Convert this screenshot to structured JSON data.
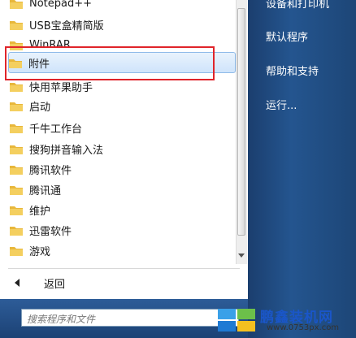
{
  "programs": [
    {
      "label": "Notepad++"
    },
    {
      "label": "USB宝盒精简版"
    },
    {
      "label": "WinRAR"
    },
    {
      "label": "附件"
    },
    {
      "label": "快用苹果助手"
    },
    {
      "label": "启动"
    },
    {
      "label": "千牛工作台"
    },
    {
      "label": "搜狗拼音输入法"
    },
    {
      "label": "腾讯软件"
    },
    {
      "label": "腾讯通"
    },
    {
      "label": "维护"
    },
    {
      "label": "迅雷软件"
    },
    {
      "label": "游戏"
    }
  ],
  "back_label": "返回",
  "search": {
    "placeholder": "搜索程序和文件"
  },
  "right_menu": [
    {
      "label": "设备和打印机"
    },
    {
      "label": "默认程序"
    },
    {
      "label": "帮助和支持"
    },
    {
      "label": "运行..."
    }
  ],
  "watermark": {
    "title": "鹏鑫装机网",
    "url": "www.0753px.com"
  },
  "colors": {
    "folder": "#e8b73b",
    "highlight": "#e0242a",
    "accent": "#1a56c8"
  }
}
